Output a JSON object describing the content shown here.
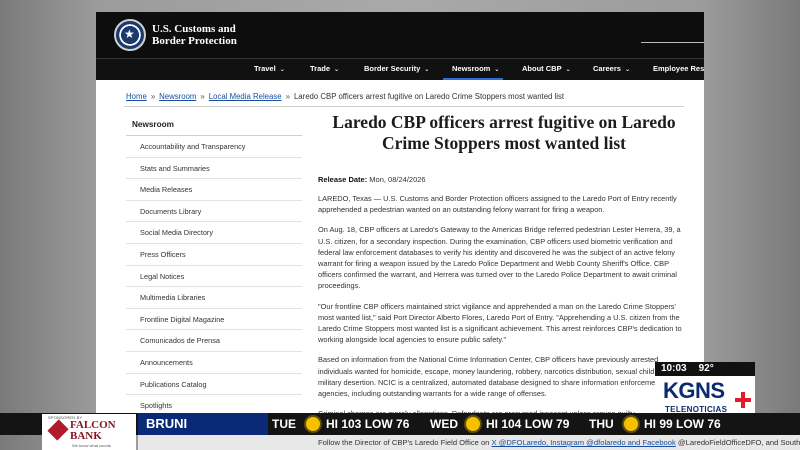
{
  "site": {
    "logo_line1": "U.S. Customs and",
    "logo_line2": "Border Protection"
  },
  "nav": {
    "items": [
      {
        "label": "Travel"
      },
      {
        "label": "Trade"
      },
      {
        "label": "Border Security"
      },
      {
        "label": "Newsroom"
      },
      {
        "label": "About CBP"
      },
      {
        "label": "Careers"
      },
      {
        "label": "Employee Reso"
      }
    ]
  },
  "breadcrumb": {
    "home": "Home",
    "newsroom": "Newsroom",
    "local": "Local Media Release",
    "current": "Laredo CBP officers arrest fugitive on Laredo Crime Stoppers most wanted list"
  },
  "sidebar": {
    "title": "Newsroom",
    "items": [
      {
        "label": "Accountability and Transparency"
      },
      {
        "label": "Stats and Summaries"
      },
      {
        "label": "Media Releases"
      },
      {
        "label": "Documents Library"
      },
      {
        "label": "Social Media Directory"
      },
      {
        "label": "Press Officers"
      },
      {
        "label": "Legal Notices"
      },
      {
        "label": "Multimedia Libraries"
      },
      {
        "label": "Frontline Digital Magazine"
      },
      {
        "label": "Comunicados de Prensa"
      },
      {
        "label": "Announcements"
      },
      {
        "label": "Publications Catalog"
      },
      {
        "label": "Spotlights"
      }
    ]
  },
  "article": {
    "headline": "Laredo CBP officers arrest fugitive on Laredo Crime Stoppers most wanted list",
    "release_label": "Release Date:",
    "release_date": "Mon, 08/24/2026",
    "p1": "LAREDO, Texas — U.S. Customs and Border Protection officers assigned to the Laredo Port of Entry recently apprehended a pedestrian wanted on an outstanding felony warrant for firing a weapon.",
    "p2": "On Aug. 18, CBP officers at Laredo's Gateway to the Americas Bridge referred pedestrian Lester Herrera, 39, a U.S. citizen, for a secondary inspection. During the examination, CBP officers used biometric verification and federal law enforcement databases to verify his identity and discovered he was the subject of an active felony warrant for firing a weapon issued by the Laredo Police Department and Webb County Sheriff's Office. CBP officers confirmed the warrant, and Herrera was turned over to the Laredo Police Department to await criminal proceedings.",
    "p3": "\"Our frontline CBP officers maintained strict vigilance and apprehended a man on the Laredo Crime Stoppers' most wanted list,\" said Port Director Alberto Flores, Laredo Port of Entry. \"Apprehending a U.S. citizen from the Laredo Crime Stoppers most wanted list is a significant achievement. This arrest reinforces CBP's dedication to working alongside local agencies to ensure public safety.\"",
    "p4": "Based on information from the National Crime Information Center, CBP officers have previously arrested individuals wanted for homicide, escape, money laundering, robbery, narcotics distribution, sexual child abu and military desertion. NCIC is a centralized, automated database designed to share information enforcement agencies, including outstanding warrants for a wide range of offenses.",
    "p5": "Criminal charges are merely allegations. Defendants are presumed innocent unless proven guilty.",
    "p6_a": "Follow the Director of CBP's Laredo Field Office on",
    "p6_link": "X @DFOLaredo, Instagram @dfolaredo and Facebook",
    "p6_b": "@LaredoFieldOfficeDFO, and South Texas Operations on X @CBPSouthTexas for breaking news, current events,"
  },
  "tv": {
    "time": "10:03",
    "temp": "92°",
    "station": "KGNS",
    "substation": "TELENOTICIAS",
    "city": "BRUNI",
    "forecast": [
      {
        "day": "TUE",
        "temp": "HI 103 LOW 76"
      },
      {
        "day": "WED",
        "temp": "HI 104 LOW 79"
      },
      {
        "day": "THU",
        "temp": "HI 99 LOW 76"
      }
    ],
    "sponsor_small": "SPONSORED BY",
    "sponsor_name1": "FALCON",
    "sponsor_name2": "BANK",
    "sponsor_tag": "We know what counts"
  }
}
